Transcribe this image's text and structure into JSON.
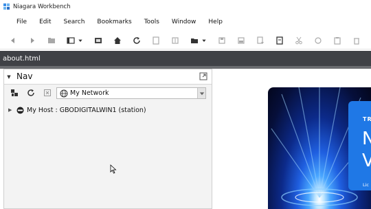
{
  "window": {
    "title": "Niagara Workbench"
  },
  "menu": [
    "File",
    "Edit",
    "Search",
    "Bookmarks",
    "Tools",
    "Window",
    "Help"
  ],
  "toolbar_icons": [
    "back-arrow-icon",
    "forward-arrow-icon",
    "folder-up-icon",
    "side-bar-icon",
    "dropdown-arrow-icon",
    "console-icon",
    "home-icon",
    "refresh-icon",
    "page-icon",
    "properties-icon",
    "open-folder-icon",
    "dropdown-arrow-icon",
    "save-icon",
    "save-all-icon",
    "export-icon",
    "new-file-icon",
    "cut-icon",
    "copy-icon",
    "paste-icon",
    "delete-icon"
  ],
  "tab": {
    "label": "about.html"
  },
  "nav": {
    "title": "Nav",
    "tools": [
      "connect-icon",
      "refresh-icon",
      "close-icon"
    ],
    "network_select": "My Network",
    "tree": [
      {
        "label": "My Host : GBODIGITALWIN1 (station)"
      }
    ]
  },
  "splash": {
    "kicker": "TR",
    "big1": "N",
    "big2": "V",
    "license": "Lic"
  },
  "colors": {
    "tab_strip": "#3f4146",
    "splash_card": "#1f78e6"
  }
}
